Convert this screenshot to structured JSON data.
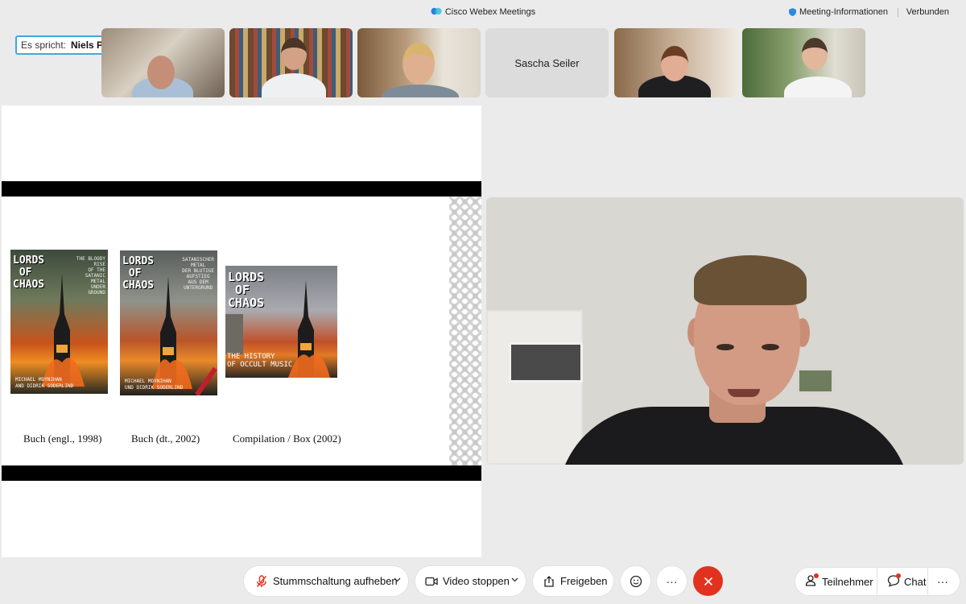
{
  "titlebar": {
    "app_title": "Cisco Webex Meetings",
    "meeting_info": "Meeting-Informationen",
    "status": "Verbunden"
  },
  "speaker": {
    "label": "Es spricht:",
    "name": "Niels Penke"
  },
  "participants": [
    {
      "name": "",
      "video": true
    },
    {
      "name": "",
      "video": true
    },
    {
      "name": "",
      "video": true
    },
    {
      "name": "Sascha Seiler",
      "video": false
    },
    {
      "name": "",
      "video": true
    },
    {
      "name": "",
      "video": true
    }
  ],
  "slide": {
    "items": [
      {
        "cover_title": "LORDS\n OF\nCHAOS",
        "cover_subtitle": "THE BLOODY\nRISE\nOF THE\nSATANIC\nMETAL\nUNDER\nGROUND",
        "cover_authors": "MICHAEL MOYNIHAN\nAND DIDRIK SODERLIND",
        "caption": "Buch (engl., 1998)"
      },
      {
        "cover_title": "LORDS\n OF\nCHAOS",
        "cover_subtitle": "SATANISCHER\nMETAL\nDER BLUTIGE\nAUFSTIEG\nAUS DEM\nUNTERGRUND",
        "cover_authors": "MICHAEL MOYNIHAN\nUND DIDRIK SODERLIND",
        "caption": "Buch (dt., 2002)"
      },
      {
        "cover_title": "LORDS\n OF\nCHAOS",
        "cover_subtitle": "THE HISTORY\nOF OCCULT MUSIC",
        "cover_authors": "",
        "caption": "Compilation / Box (2002)"
      }
    ]
  },
  "toolbar": {
    "unmute_label": "Stummschaltung aufheben",
    "video_label": "Video stoppen",
    "share_label": "Freigeben",
    "more_label": "···",
    "participants_label": "Teilnehmer",
    "chat_label": "Chat",
    "overflow_label": "···"
  },
  "colors": {
    "accent": "#3fa9e0",
    "end_call": "#e0321f",
    "notification": "#e0321f"
  }
}
